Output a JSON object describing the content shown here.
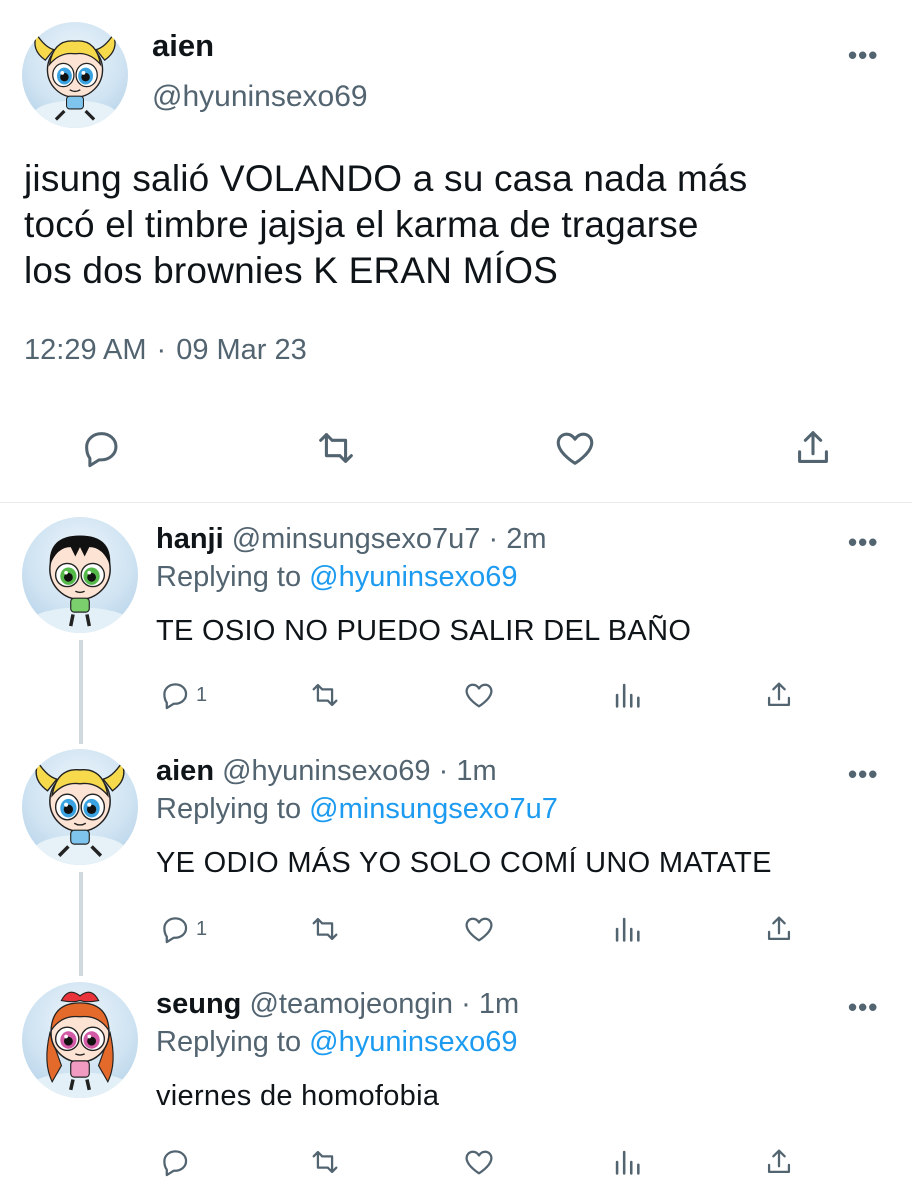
{
  "main_tweet": {
    "name": "aien",
    "handle": "@hyuninsexo69",
    "text_line1": "jisung salió VOLANDO a su casa nada más",
    "text_line2": "tocó el timbre jajsja el karma de tragarse",
    "text_line3": "los dos brownies K ERAN MÍOS",
    "time": "12:29 AM",
    "separator": "·",
    "date": "09 Mar 23",
    "more": "•••",
    "actions": [
      "reply-icon",
      "retweet-icon",
      "like-icon",
      "share-icon"
    ]
  },
  "replies": [
    {
      "name": "hanji",
      "handle": "@minsungsexo7u7",
      "dot": "·",
      "time": "2m",
      "replying_prefix": "Replying to ",
      "replying_to": "@hyuninsexo69",
      "text": "TE OSIO NO PUEDO SALIR DEL BAÑO",
      "reply_count": "1",
      "more": "•••",
      "avatar_character": "buttercup"
    },
    {
      "name": "aien",
      "handle": "@hyuninsexo69",
      "dot": "·",
      "time": "1m",
      "replying_prefix": "Replying to ",
      "replying_to": "@minsungsexo7u7",
      "text": "YE ODIO MÁS YO SOLO COMÍ UNO MATATE",
      "reply_count": "1",
      "more": "•••",
      "avatar_character": "bubbles"
    },
    {
      "name": "seung",
      "handle": "@teamojeongin",
      "dot": "·",
      "time": "1m",
      "replying_prefix": "Replying to ",
      "replying_to": "@hyuninsexo69",
      "text": "viernes de homofobia",
      "reply_count": "",
      "more": "•••",
      "avatar_character": "blossom"
    }
  ],
  "colors": {
    "text": "#0f1419",
    "secondary": "#536471",
    "link": "#1d9bf0",
    "divider": "#e7e9ea",
    "thread_line": "#cfd9de"
  }
}
